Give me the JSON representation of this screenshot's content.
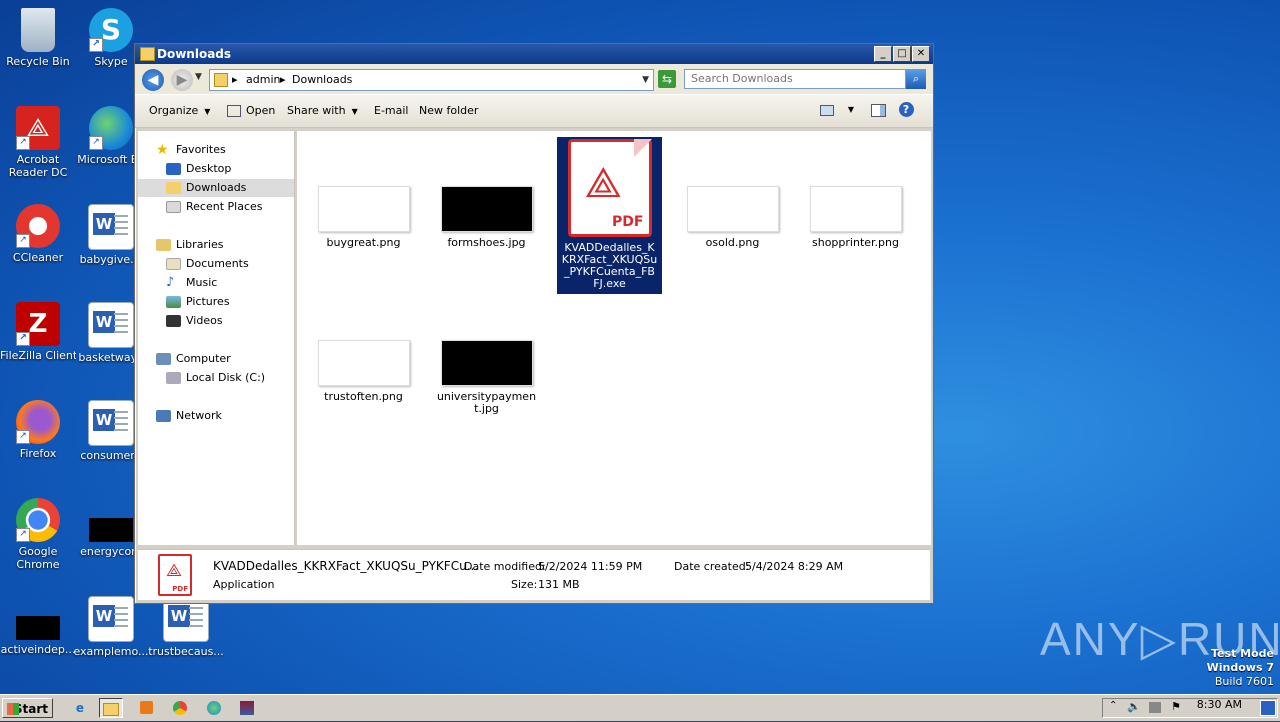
{
  "desktop": {
    "icons": [
      {
        "label": "Recycle Bin"
      },
      {
        "label": "Skype"
      },
      {
        "label": "Acrobat Reader DC"
      },
      {
        "label": "Microsoft Ed"
      },
      {
        "label": "CCleaner"
      },
      {
        "label": "babygive.rt"
      },
      {
        "label": "FileZilla Client"
      },
      {
        "label": "basketway.r"
      },
      {
        "label": "Firefox"
      },
      {
        "label": "consumerd"
      },
      {
        "label": "Google Chrome"
      },
      {
        "label": "energycom"
      },
      {
        "label": "activeindep..."
      },
      {
        "label": "examplemo..."
      },
      {
        "label": "trustbecaus..."
      }
    ]
  },
  "window": {
    "title": "Downloads",
    "buttons": {
      "minimize": "_",
      "maximize": "□",
      "close": "✕"
    }
  },
  "address": {
    "crumbs": [
      "admin",
      "Downloads"
    ],
    "separator": "▸",
    "search_placeholder": "Search Downloads"
  },
  "toolbar": {
    "organize": "Organize",
    "open": "Open",
    "share_with": "Share with",
    "email": "E-mail",
    "new_folder": "New folder"
  },
  "nav": {
    "favorites": "Favorites",
    "desktop": "Desktop",
    "downloads": "Downloads",
    "recent": "Recent Places",
    "libraries": "Libraries",
    "documents": "Documents",
    "music": "Music",
    "pictures": "Pictures",
    "videos": "Videos",
    "computer": "Computer",
    "local_disk": "Local Disk (C:)",
    "network": "Network"
  },
  "files": [
    {
      "name": "buygreat.png"
    },
    {
      "name": "formshoes.jpg"
    },
    {
      "name": "KVADDedalles_KKRXFact_XKUQSu_PYKFCuenta_FBFJ.exe",
      "pdf_label": "PDF"
    },
    {
      "name": "osold.png"
    },
    {
      "name": "shopprinter.png"
    },
    {
      "name": "trustoften.png"
    },
    {
      "name": "universitypayment.jpg"
    }
  ],
  "details": {
    "name": "KVADDedalles_KKRXFact_XKUQSu_PYKFCu...",
    "type": "Application",
    "date_modified_label": "Date modified:",
    "date_modified": "5/2/2024 11:59 PM",
    "size_label": "Size:",
    "size": "131 MB",
    "date_created_label": "Date created:",
    "date_created": "5/4/2024 8:29 AM",
    "icon_label": "PDF"
  },
  "watermark": {
    "brand": "ANY▷RUN",
    "line1": "Test Mode",
    "line2": "Windows 7",
    "line3": "Build 7601"
  },
  "taskbar": {
    "start": "Start",
    "clock": "8:30 AM"
  }
}
